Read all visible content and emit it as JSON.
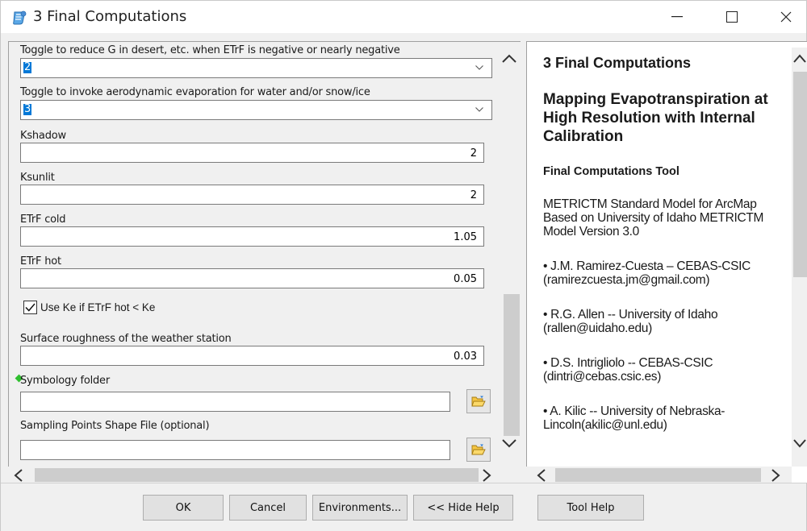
{
  "window": {
    "title": "3 Final Computations"
  },
  "form": {
    "fields": [
      {
        "label": "Toggle to reduce G in desert, etc. when ETrF is negative or nearly negative",
        "value": "2"
      },
      {
        "label": "Toggle to invoke aerodynamic evaporation for water and/or snow/ice",
        "value": "3"
      },
      {
        "label": "Kshadow",
        "value": "2"
      },
      {
        "label": "Ksunlit",
        "value": "2"
      },
      {
        "label": "ETrF cold",
        "value": "1.05"
      },
      {
        "label": "ETrF hot",
        "value": "0.05"
      },
      {
        "label": "Surface roughness of the weather station",
        "value": "0.03"
      },
      {
        "label": "Symbology folder",
        "value": ""
      },
      {
        "label": "Sampling Points Shape File (optional)",
        "value": ""
      }
    ],
    "checkbox": {
      "label": "Use Ke if ETrF hot < Ke",
      "checked": true
    }
  },
  "help": {
    "title": "3 Final Computations",
    "subtitle": "Mapping Evapotranspiration at High Resolution with Internal Calibration",
    "section": "Final Computations Tool",
    "intro": "METRICTM Standard Model for ArcMap Based on University of Idaho METRICTM Model Version 3.0",
    "authors": [
      "• J.M. Ramirez-Cuesta – CEBAS-CSIC (ramirezcuesta.jm@gmail.com)",
      "• R.G. Allen -- University of Idaho (rallen@uidaho.edu)",
      "• D.S. Intrigliolo -- CEBAS-CSIC (dintri@cebas.csic.es)",
      "• A. Kilic -- University of Nebraska-Lincoln(akilic@unl.edu)"
    ]
  },
  "buttons": {
    "ok": "OK",
    "cancel": "Cancel",
    "environments": "Environments...",
    "hide_help": "<< Hide Help",
    "tool_help": "Tool Help"
  },
  "icons": {
    "app": "script-tool-icon",
    "minimize": "minimize-icon",
    "maximize": "maximize-icon",
    "close": "close-icon",
    "browse": "open-folder-icon"
  }
}
